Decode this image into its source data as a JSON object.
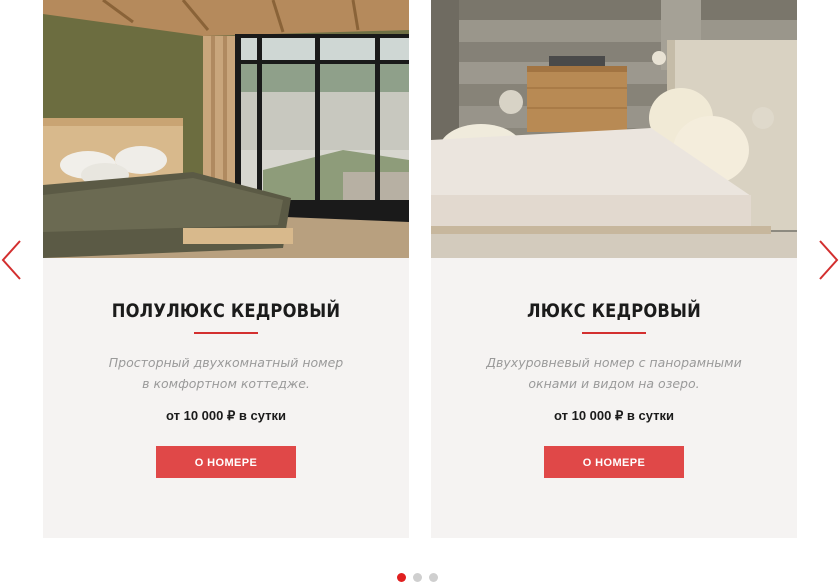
{
  "slider": {
    "prev_icon": "chevron-left-icon",
    "next_icon": "chevron-right-icon",
    "accent_color": "#d32f2f",
    "pagination": {
      "count": 3,
      "active_index": 0
    }
  },
  "cards": [
    {
      "title": "ПОЛУЛЮКС КЕДРОВЫЙ",
      "description_line1": "Просторный двухкомнатный номер",
      "description_line2": "в комфортном коттедже.",
      "price": "от 10 000 ₽ в сутки",
      "button": "О НОМЕРЕ"
    },
    {
      "title": "ЛЮКС КЕДРОВЫЙ",
      "description_line1": "Двухуровневый номер с панорамными",
      "description_line2": "окнами и видом на озеро.",
      "price": "от 10 000 ₽ в сутки",
      "button": "О НОМЕРЕ"
    }
  ]
}
